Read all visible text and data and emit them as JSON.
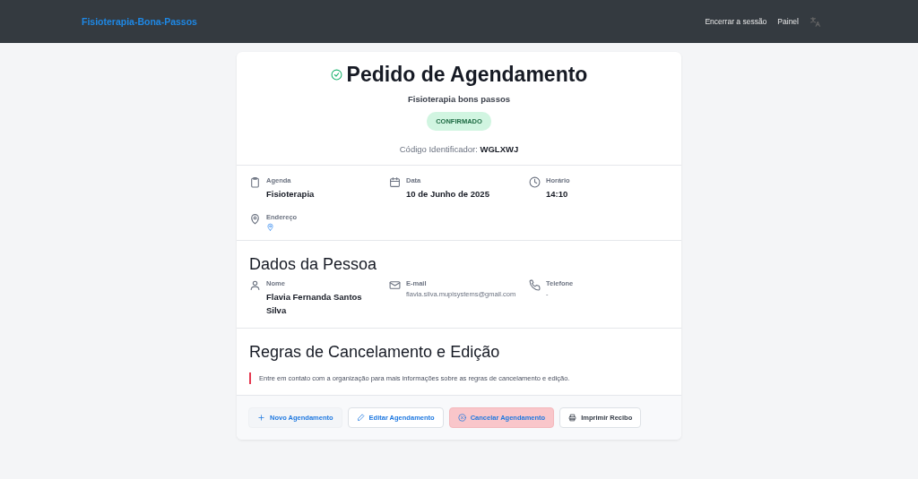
{
  "navbar": {
    "brand": "Fisioterapia-Bona-Passos",
    "links": [
      "Encerrar a sessão",
      "Painel"
    ]
  },
  "header": {
    "title": "Pedido de Agendamento",
    "subtitle": "Fisioterapia bons passos",
    "status": "CONFIRMADO",
    "code_label": "Código Identificador:",
    "code": "WGLXWJ"
  },
  "details": [
    {
      "label": "Agenda",
      "value": "Fisioterapia"
    },
    {
      "label": "Data",
      "value": "10 de Junho de 2025"
    },
    {
      "label": "Horário",
      "value": "14:10"
    },
    {
      "label": "Endereço",
      "map_link": true
    }
  ],
  "person": {
    "title": "Dados da Pessoa",
    "fields": [
      {
        "label": "Nome",
        "value": "Flavia Fernanda Santos Silva",
        "kind": "strong"
      },
      {
        "label": "E-mail",
        "value": "flavia.silva.mupisystems@gmail.com",
        "kind": "plain"
      },
      {
        "label": "Telefone",
        "value": "-",
        "kind": "plain"
      }
    ]
  },
  "rules": {
    "title": "Regras de Cancelamento e Edição",
    "text": "Entre em contato com a organização para mais informações sobre as regras de cancelamento e edição."
  },
  "actions": [
    {
      "kind": "new",
      "label": "Novo Agendamento"
    },
    {
      "kind": "edit",
      "label": "Editar Agendamento"
    },
    {
      "kind": "cancel",
      "label": "Cancelar Agendamento"
    },
    {
      "kind": "print",
      "label": "Imprimir Recibo"
    }
  ]
}
